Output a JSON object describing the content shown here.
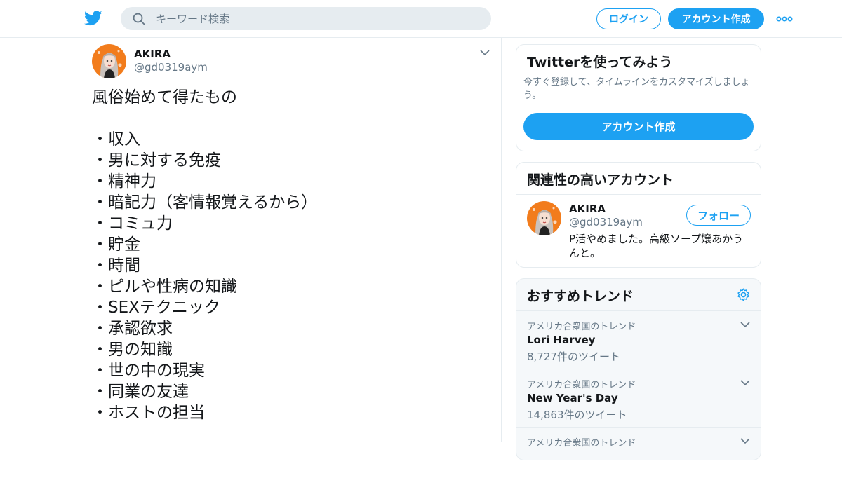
{
  "header": {
    "logo": "twitter-bird-icon",
    "search_placeholder": "キーワード検索",
    "login_label": "ログイン",
    "signup_label": "アカウント作成",
    "more_icon": "more-dots-icon"
  },
  "tweet": {
    "display_name": "AKIRA",
    "handle": "@gd0319aym",
    "text": "風俗始めて得たもの\n\n・収入\n・男に対する免疫\n・精神力\n・暗記力（客情報覚えるから）\n・コミュ力\n・貯金\n・時間\n・ピルや性病の知識\n・SEXテクニック\n・承認欲求\n・男の知識\n・世の中の現実\n・同業の友達\n・ホストの担当"
  },
  "signup_card": {
    "title": "Twitterを使ってみよう",
    "subtitle": "今すぐ登録して、タイムラインをカスタマイズしましょう。",
    "button_label": "アカウント作成"
  },
  "related_card": {
    "title": "関連性の高いアカウント",
    "display_name": "AKIRA",
    "handle": "@gd0319aym",
    "follow_label": "フォロー",
    "bio": "P活やめました。高級ソープ嬢あかうんと。"
  },
  "trends_card": {
    "title": "おすすめトレンド",
    "items": [
      {
        "context": "アメリカ合衆国のトレンド",
        "name": "Lori Harvey",
        "count": "8,727件のツイート"
      },
      {
        "context": "アメリカ合衆国のトレンド",
        "name": "New Year's Day",
        "count": "14,863件のツイート"
      },
      {
        "context": "アメリカ合衆国のトレンド",
        "name": "",
        "count": ""
      }
    ]
  },
  "colors": {
    "accent": "#1da1f2",
    "text": "#14171a",
    "secondary": "#657786",
    "border": "#e6ecf0",
    "avatar_bg": "#f27c1c"
  }
}
